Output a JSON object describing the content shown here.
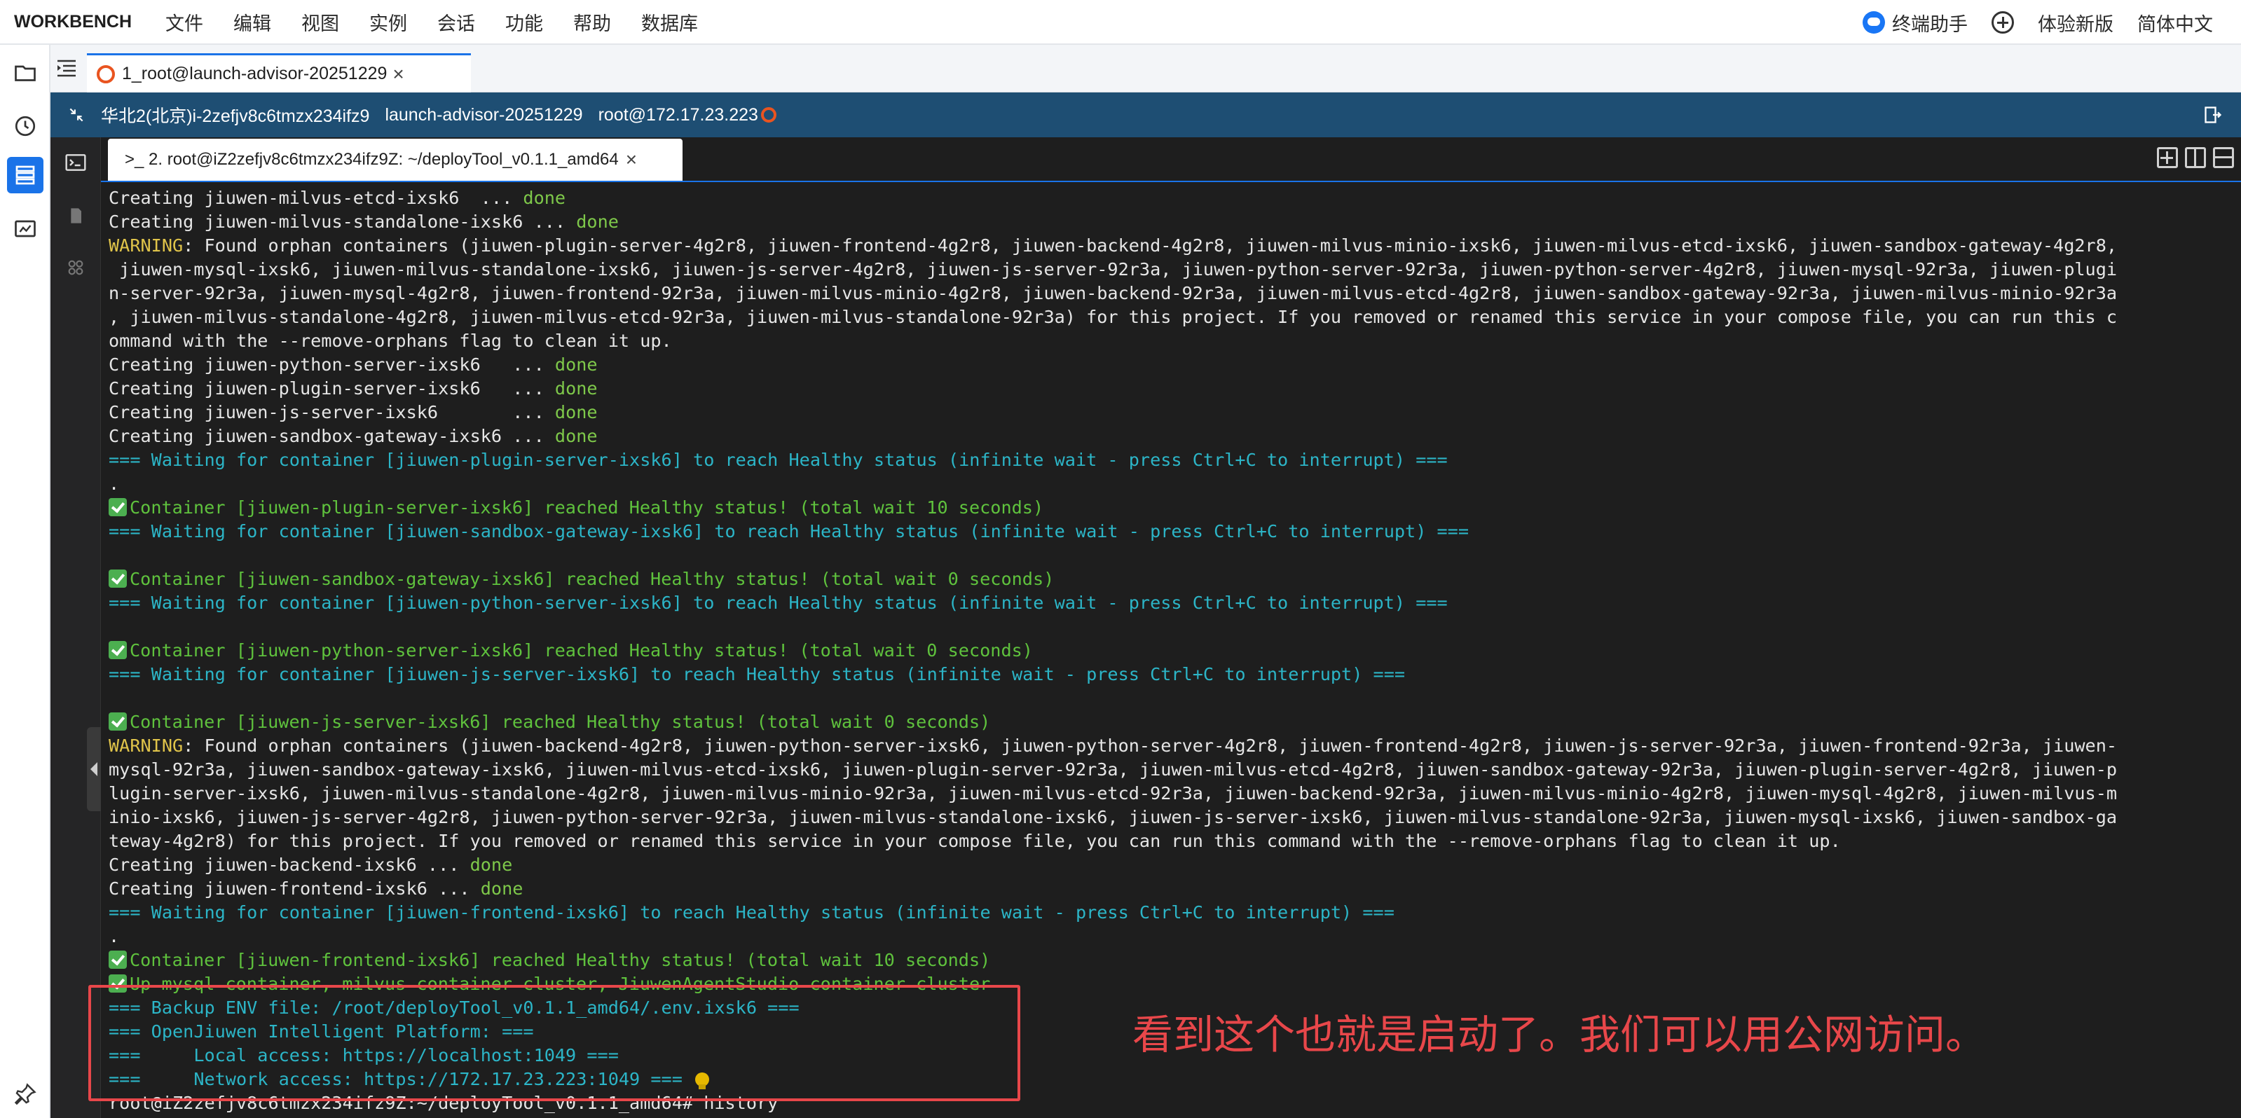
{
  "menubar": {
    "brand": "WORKBENCH",
    "items": [
      "文件",
      "编辑",
      "视图",
      "实例",
      "会话",
      "功能",
      "帮助",
      "数据库"
    ],
    "assistant": "终端助手",
    "try_new": "体验新版",
    "language": "简体中文"
  },
  "session_tab": {
    "label": "1_root@launch-advisor-20251229",
    "close": "×"
  },
  "host_bar": {
    "region": "华北2(北京)i-2zefjv8c6tmzx234ifz9",
    "instance": "launch-advisor-20251229",
    "user": "root@172.17.23.223"
  },
  "terminal_tab": {
    "label": ">_ 2. root@iZ2zefjv8c6tmzx234ifz9Z: ~/deployTool_v0.1.1_amd64",
    "close": "×"
  },
  "terminal": {
    "lines": [
      [
        [
          "def",
          "Creating jiuwen-milvus-etcd-ixsk6  ... "
        ],
        [
          "green",
          "done"
        ]
      ],
      [
        [
          "def",
          "Creating jiuwen-milvus-standalone-ixsk6 ... "
        ],
        [
          "green",
          "done"
        ]
      ],
      [
        [
          "yellow",
          "WARNING"
        ],
        [
          "def",
          ": Found orphan containers (jiuwen-plugin-server-4g2r8, jiuwen-frontend-4g2r8, jiuwen-backend-4g2r8, jiuwen-milvus-minio-ixsk6, jiuwen-milvus-etcd-ixsk6, jiuwen-sandbox-gateway-4g2r8,"
        ]
      ],
      [
        [
          "def",
          " jiuwen-mysql-ixsk6, jiuwen-milvus-standalone-ixsk6, jiuwen-js-server-4g2r8, jiuwen-js-server-92r3a, jiuwen-python-server-92r3a, jiuwen-python-server-4g2r8, jiuwen-mysql-92r3a, jiuwen-plugi"
        ]
      ],
      [
        [
          "def",
          "n-server-92r3a, jiuwen-mysql-4g2r8, jiuwen-frontend-92r3a, jiuwen-milvus-minio-4g2r8, jiuwen-backend-92r3a, jiuwen-milvus-etcd-4g2r8, jiuwen-sandbox-gateway-92r3a, jiuwen-milvus-minio-92r3a"
        ]
      ],
      [
        [
          "def",
          ", jiuwen-milvus-standalone-4g2r8, jiuwen-milvus-etcd-92r3a, jiuwen-milvus-standalone-92r3a) for this project. If you removed or renamed this service in your compose file, you can run this c"
        ]
      ],
      [
        [
          "def",
          "ommand with the --remove-orphans flag to clean it up."
        ]
      ],
      [
        [
          "def",
          "Creating jiuwen-python-server-ixsk6   ... "
        ],
        [
          "green",
          "done"
        ]
      ],
      [
        [
          "def",
          "Creating jiuwen-plugin-server-ixsk6   ... "
        ],
        [
          "green",
          "done"
        ]
      ],
      [
        [
          "def",
          "Creating jiuwen-js-server-ixsk6       ... "
        ],
        [
          "green",
          "done"
        ]
      ],
      [
        [
          "def",
          "Creating jiuwen-sandbox-gateway-ixsk6 ... "
        ],
        [
          "green",
          "done"
        ]
      ],
      [
        [
          "cyan",
          "=== Waiting for container [jiuwen-plugin-server-ixsk6] to reach Healthy status (infinite wait - press Ctrl+C to interrupt) ==="
        ]
      ],
      [
        [
          "def",
          "."
        ]
      ],
      [
        [
          "check",
          ""
        ],
        [
          "green2",
          "Container [jiuwen-plugin-server-ixsk6] reached Healthy status! (total wait 10 seconds)"
        ]
      ],
      [
        [
          "cyan",
          "=== Waiting for container [jiuwen-sandbox-gateway-ixsk6] to reach Healthy status (infinite wait - press Ctrl+C to interrupt) ==="
        ]
      ],
      [
        [
          "def",
          ""
        ]
      ],
      [
        [
          "check",
          ""
        ],
        [
          "green2",
          "Container [jiuwen-sandbox-gateway-ixsk6] reached Healthy status! (total wait 0 seconds)"
        ]
      ],
      [
        [
          "cyan",
          "=== Waiting for container [jiuwen-python-server-ixsk6] to reach Healthy status (infinite wait - press Ctrl+C to interrupt) ==="
        ]
      ],
      [
        [
          "def",
          ""
        ]
      ],
      [
        [
          "check",
          ""
        ],
        [
          "green2",
          "Container [jiuwen-python-server-ixsk6] reached Healthy status! (total wait 0 seconds)"
        ]
      ],
      [
        [
          "cyan",
          "=== Waiting for container [jiuwen-js-server-ixsk6] to reach Healthy status (infinite wait - press Ctrl+C to interrupt) ==="
        ]
      ],
      [
        [
          "def",
          ""
        ]
      ],
      [
        [
          "check",
          ""
        ],
        [
          "green2",
          "Container [jiuwen-js-server-ixsk6] reached Healthy status! (total wait 0 seconds)"
        ]
      ],
      [
        [
          "yellow",
          "WARNING"
        ],
        [
          "def",
          ": Found orphan containers (jiuwen-backend-4g2r8, jiuwen-python-server-ixsk6, jiuwen-python-server-4g2r8, jiuwen-frontend-4g2r8, jiuwen-js-server-92r3a, jiuwen-frontend-92r3a, jiuwen-"
        ]
      ],
      [
        [
          "def",
          "mysql-92r3a, jiuwen-sandbox-gateway-ixsk6, jiuwen-milvus-etcd-ixsk6, jiuwen-plugin-server-92r3a, jiuwen-milvus-etcd-4g2r8, jiuwen-sandbox-gateway-92r3a, jiuwen-plugin-server-4g2r8, jiuwen-p"
        ]
      ],
      [
        [
          "def",
          "lugin-server-ixsk6, jiuwen-milvus-standalone-4g2r8, jiuwen-milvus-minio-92r3a, jiuwen-milvus-etcd-92r3a, jiuwen-backend-92r3a, jiuwen-milvus-minio-4g2r8, jiuwen-mysql-4g2r8, jiuwen-milvus-m"
        ]
      ],
      [
        [
          "def",
          "inio-ixsk6, jiuwen-js-server-4g2r8, jiuwen-python-server-92r3a, jiuwen-milvus-standalone-ixsk6, jiuwen-js-server-ixsk6, jiuwen-milvus-standalone-92r3a, jiuwen-mysql-ixsk6, jiuwen-sandbox-ga"
        ]
      ],
      [
        [
          "def",
          "teway-4g2r8) for this project. If you removed or renamed this service in your compose file, you can run this command with the --remove-orphans flag to clean it up."
        ]
      ],
      [
        [
          "def",
          "Creating jiuwen-backend-ixsk6 ... "
        ],
        [
          "green",
          "done"
        ]
      ],
      [
        [
          "def",
          "Creating jiuwen-frontend-ixsk6 ... "
        ],
        [
          "green",
          "done"
        ]
      ],
      [
        [
          "cyan",
          "=== Waiting for container [jiuwen-frontend-ixsk6] to reach Healthy status (infinite wait - press Ctrl+C to interrupt) ==="
        ]
      ],
      [
        [
          "def",
          "."
        ]
      ],
      [
        [
          "check",
          ""
        ],
        [
          "green2",
          "Container [jiuwen-frontend-ixsk6] reached Healthy status! (total wait 10 seconds)"
        ]
      ],
      [
        [
          "check",
          ""
        ],
        [
          "green2",
          "Up mysql container, milvus container cluster, JiuwenAgentStudio container cluster"
        ]
      ],
      [
        [
          "cyan",
          "=== Backup ENV file: /root/deployTool_v0.1.1_amd64/.env.ixsk6 ==="
        ]
      ],
      [
        [
          "cyan",
          "=== OpenJiuwen Intelligent Platform: ==="
        ]
      ],
      [
        [
          "cyan",
          "===     Local access: https://localhost:1049 ==="
        ]
      ],
      [
        [
          "cyan",
          "===     Network access: https://172.17.23.223:1049 ==="
        ],
        [
          "bulb",
          ""
        ]
      ],
      [
        [
          "def",
          "root@iZ2zefjv8c6tmzx234ifz9Z:~/deployTool_v0.1.1_amd64# history"
        ]
      ]
    ]
  },
  "annotation": {
    "text": "看到这个也就是启动了。我们可以用公网访问。"
  },
  "colors": {
    "accent": "#1a73e8",
    "host_bar_bg": "#1e4e73",
    "annotation_red": "#e8474a",
    "terminal_bg": "#1e1e1e",
    "done_green": "#7ec84a",
    "warning_yellow": "#e0c44a",
    "waiting_cyan": "#2cb5c7"
  }
}
